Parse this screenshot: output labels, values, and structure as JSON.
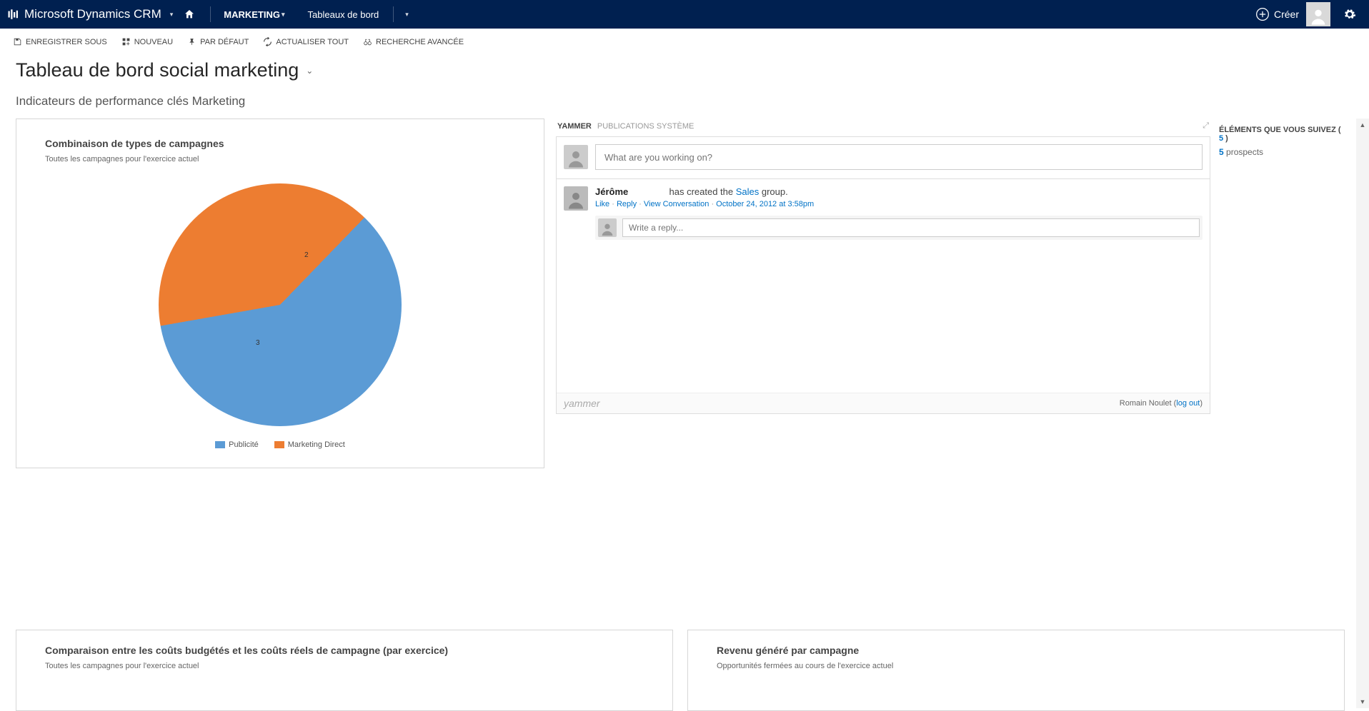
{
  "nav": {
    "brand": "Microsoft Dynamics CRM",
    "area": "MARKETING",
    "sub": "Tableaux de bord",
    "create": "Créer"
  },
  "cmd": {
    "save_as": "ENREGISTRER SOUS",
    "new": "NOUVEAU",
    "default": "PAR DÉFAUT",
    "refresh": "ACTUALISER TOUT",
    "adv_find": "RECHERCHE AVANCÉE"
  },
  "page": {
    "title": "Tableau de bord social marketing",
    "section": "Indicateurs de performance clés Marketing"
  },
  "card_pie": {
    "title": "Combinaison de types de campagnes",
    "subtitle": "Toutes les campagnes pour l'exercice actuel"
  },
  "card_costs": {
    "title": "Comparaison entre les coûts budgétés et les coûts réels de campagne (par exercice)",
    "subtitle": "Toutes les campagnes pour l'exercice actuel"
  },
  "card_revenue": {
    "title": "Revenu généré par campagne",
    "subtitle": "Opportunités fermées au cours de l'exercice actuel"
  },
  "chart_data": {
    "type": "pie",
    "title": "Combinaison de types de campagnes",
    "series": [
      {
        "name": "Publicité",
        "value": 3,
        "color": "#5B9BD5"
      },
      {
        "name": "Marketing Direct",
        "value": 2,
        "color": "#ED7D31"
      }
    ]
  },
  "yammer": {
    "tab_active": "YAMMER",
    "tab_inactive": "PUBLICATIONS SYSTÈME",
    "compose_placeholder": "What are you working on?",
    "post_author": "Jérôme",
    "post_text_prefix": "has created the ",
    "post_text_link": "Sales",
    "post_text_suffix": " group.",
    "post_like": "Like",
    "post_reply": "Reply",
    "post_view": "View Conversation",
    "post_time": "October 24, 2012 at 3:58pm",
    "reply_placeholder": "Write a reply...",
    "footer_brand": "yammer",
    "footer_user": "Romain Noulet",
    "footer_logout": "log out"
  },
  "follow": {
    "heading": "ÉLÉMENTS QUE VOUS SUIVEZ",
    "count": "5",
    "line_count": "5",
    "line_text": "prospects"
  }
}
